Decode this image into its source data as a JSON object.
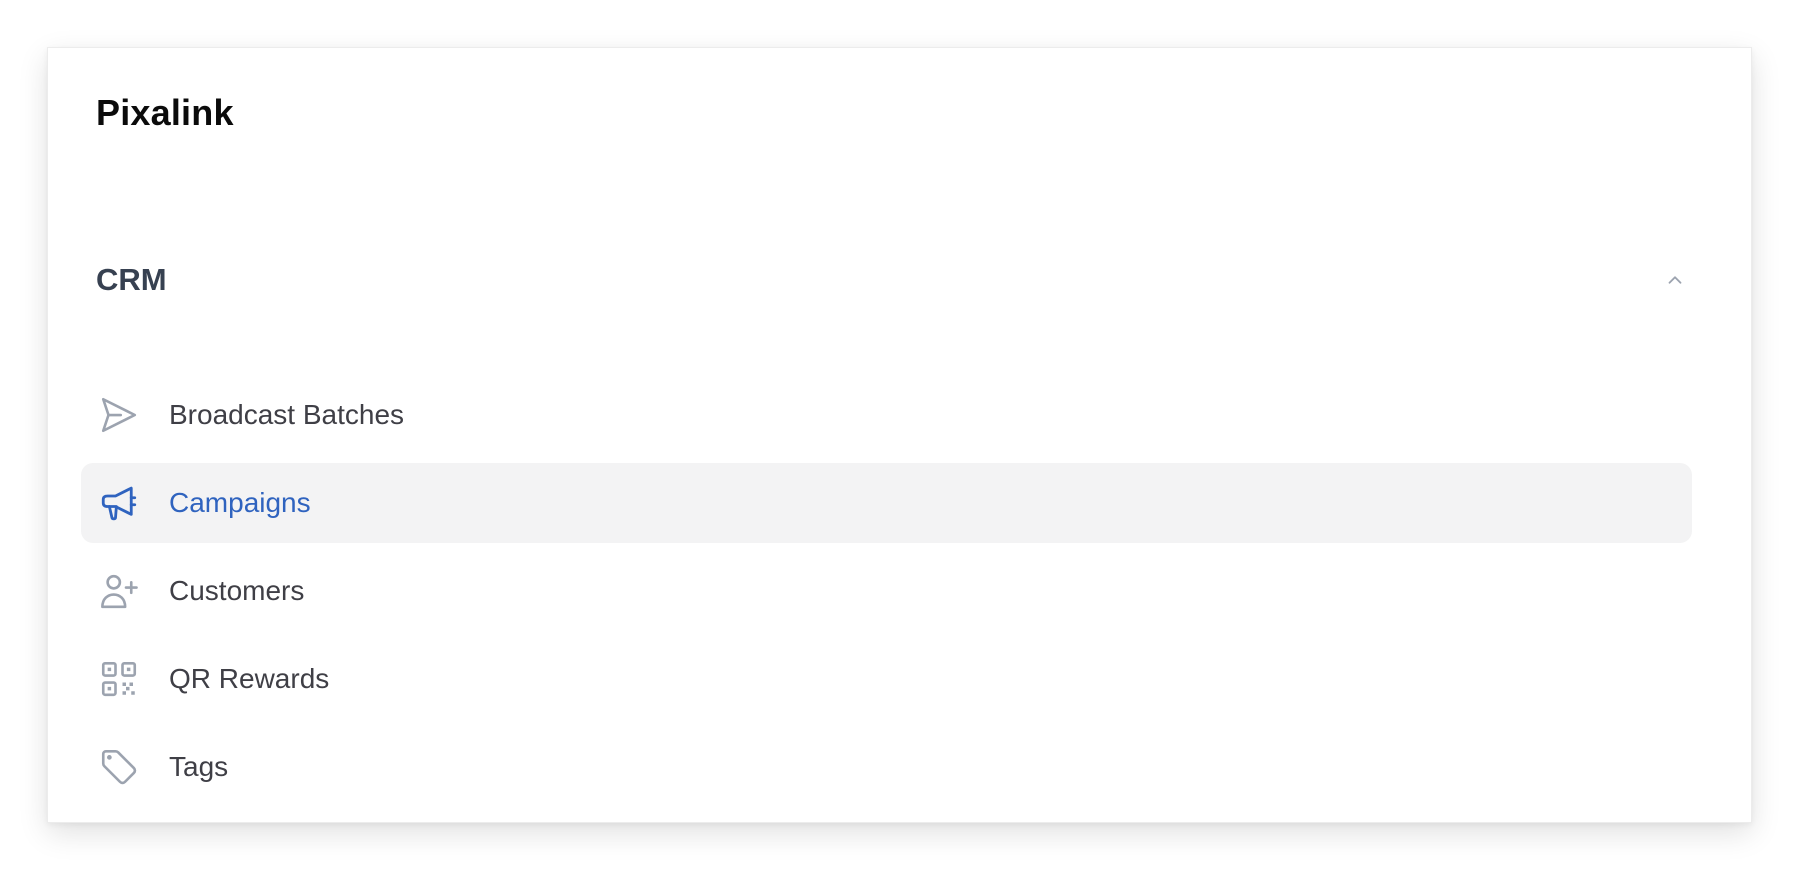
{
  "app": {
    "brand": "Pixalink"
  },
  "colors": {
    "accent": "#2f63bf",
    "icon_default": "#9ca3af",
    "active_bg": "#f3f3f4",
    "text": "#3f3f46"
  },
  "sidebar": {
    "group": {
      "title": "CRM",
      "expanded": true,
      "toggle_icon": "chevron-up-icon"
    },
    "items": [
      {
        "label": "Broadcast Batches",
        "icon": "paper-plane-icon",
        "active": false
      },
      {
        "label": "Campaigns",
        "icon": "megaphone-icon",
        "active": true
      },
      {
        "label": "Customers",
        "icon": "user-plus-icon",
        "active": false
      },
      {
        "label": "QR Rewards",
        "icon": "qr-code-icon",
        "active": false
      },
      {
        "label": "Tags",
        "icon": "tag-icon",
        "active": false
      }
    ]
  }
}
